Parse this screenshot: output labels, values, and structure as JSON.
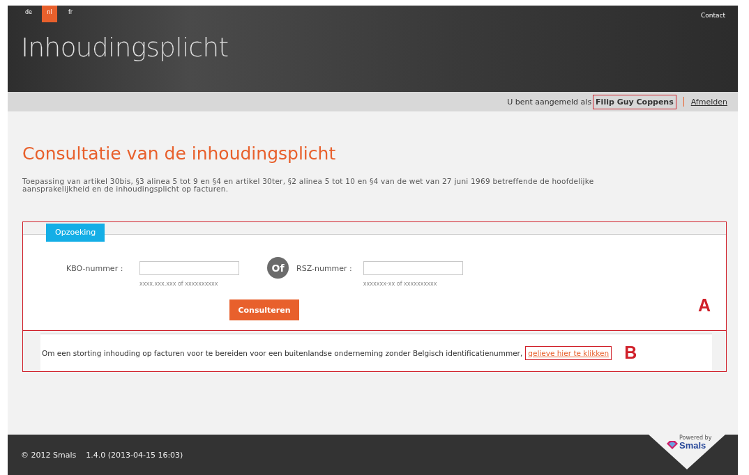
{
  "languages": [
    {
      "label": "de",
      "selected": false
    },
    {
      "label": "nl",
      "selected": true
    },
    {
      "label": "fr",
      "selected": false
    }
  ],
  "header": {
    "title": "Inhoudingsplicht",
    "contact": "Contact"
  },
  "user_bar": {
    "prefix": "U bent aangemeld als",
    "user": "Filip Guy Coppens",
    "logout": "Afmelden"
  },
  "page": {
    "heading": "Consultatie van de inhoudingsplicht",
    "intro": "Toepassing van artikel 30bis, §3 alinea 5 tot 9 en §4 en artikel 30ter, §2 alinea 5 tot 10 en §4 van de wet van 27 juni 1969 betreffende de hoofdelijke aansprakelijkheid en de inhoudingsplicht op facturen."
  },
  "search": {
    "tab": "Opzoeking",
    "fields": [
      {
        "label": "KBO-nummer :",
        "hint": "xxxx.xxx.xxx of xxxxxxxxxx"
      },
      {
        "label": "RSZ-nummer :",
        "hint": "xxxxxxx-xx of xxxxxxxxxx"
      }
    ],
    "separator": "Of",
    "button": "Consulteren",
    "marker": "A"
  },
  "foreign": {
    "text": "Om een storting inhouding op facturen voor te bereiden voor een buitenlandse onderneming zonder Belgisch identificatienummer,",
    "link": "gelieve hier te klikken",
    "marker": "B"
  },
  "footer": {
    "copyright": "© 2012 Smals",
    "version": "1.4.0 (2013-04-15 16:03)",
    "powered_by": "Powered by",
    "brand": "Smals"
  }
}
